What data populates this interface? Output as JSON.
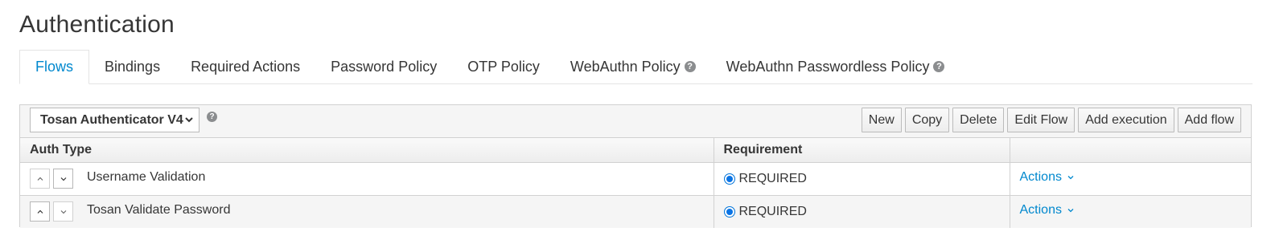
{
  "page": {
    "title": "Authentication"
  },
  "tabs": [
    {
      "label": "Flows",
      "active": true,
      "help": false
    },
    {
      "label": "Bindings",
      "active": false,
      "help": false
    },
    {
      "label": "Required Actions",
      "active": false,
      "help": false
    },
    {
      "label": "Password Policy",
      "active": false,
      "help": false
    },
    {
      "label": "OTP Policy",
      "active": false,
      "help": false
    },
    {
      "label": "WebAuthn Policy",
      "active": false,
      "help": true
    },
    {
      "label": "WebAuthn Passwordless Policy",
      "active": false,
      "help": true
    }
  ],
  "toolbar": {
    "flow_select": "Tosan Authenticator V4",
    "buttons": {
      "new": "New",
      "copy": "Copy",
      "delete": "Delete",
      "edit_flow": "Edit Flow",
      "add_execution": "Add execution",
      "add_flow": "Add flow"
    }
  },
  "table": {
    "headers": {
      "auth_type": "Auth Type",
      "requirement": "Requirement",
      "actions": ""
    },
    "rows": [
      {
        "auth_type": "Username Validation",
        "requirement": "REQUIRED",
        "actions": "Actions"
      },
      {
        "auth_type": "Tosan Validate Password",
        "requirement": "REQUIRED",
        "actions": "Actions"
      }
    ]
  },
  "colors": {
    "accent": "#0088ce",
    "radio": "#0b74e5",
    "border": "#d1d1d1",
    "toolbar_bg": "#f5f5f5"
  },
  "icons": {
    "help": "question-circle-icon",
    "select_caret": "chevron-down-icon",
    "move_up": "chevron-up-icon",
    "move_down": "chevron-down-icon",
    "actions_caret": "chevron-down-icon"
  }
}
